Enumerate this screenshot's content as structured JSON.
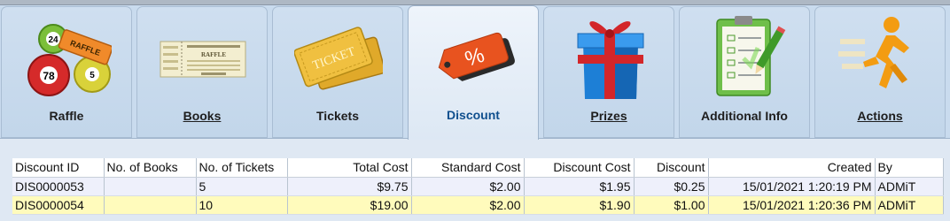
{
  "tabs": [
    {
      "label": "Raffle",
      "icon": "raffle-balls-icon",
      "active": false
    },
    {
      "label": "Books",
      "icon": "raffle-book-icon",
      "active": false
    },
    {
      "label": "Tickets",
      "icon": "tickets-icon",
      "active": false
    },
    {
      "label": "Discount",
      "icon": "discount-tag-icon",
      "active": true
    },
    {
      "label": "Prizes",
      "icon": "gift-box-icon",
      "active": false
    },
    {
      "label": "Additional Info",
      "icon": "clipboard-icon",
      "active": false
    },
    {
      "label": "Actions",
      "icon": "running-man-icon",
      "active": false
    }
  ],
  "icon_texts": {
    "balls": [
      "24",
      "78",
      "5"
    ],
    "raffle_tag": "RAFFLE",
    "book_title": "RAFFLE",
    "ticket": "TICKET",
    "percent": "%"
  },
  "table": {
    "columns": [
      "Discount ID",
      "No. of Books",
      "No. of Tickets",
      "Total Cost",
      "Standard Cost",
      "Discount Cost",
      "Discount",
      "Created",
      "By"
    ],
    "rows": [
      [
        "DIS0000053",
        "",
        "5",
        "$9.75",
        "$2.00",
        "$1.95",
        "$0.25",
        "15/01/2021 1:20:19 PM",
        "ADMiT"
      ],
      [
        "DIS0000054",
        "",
        "10",
        "$19.00",
        "$2.00",
        "$1.90",
        "$1.00",
        "15/01/2021 1:20:36 PM",
        "ADMiT"
      ]
    ]
  },
  "colors": {
    "active_tab_label": "#0f4f8e",
    "row_highlight": "#fffbbc",
    "discount_tag": "#e8531f"
  }
}
